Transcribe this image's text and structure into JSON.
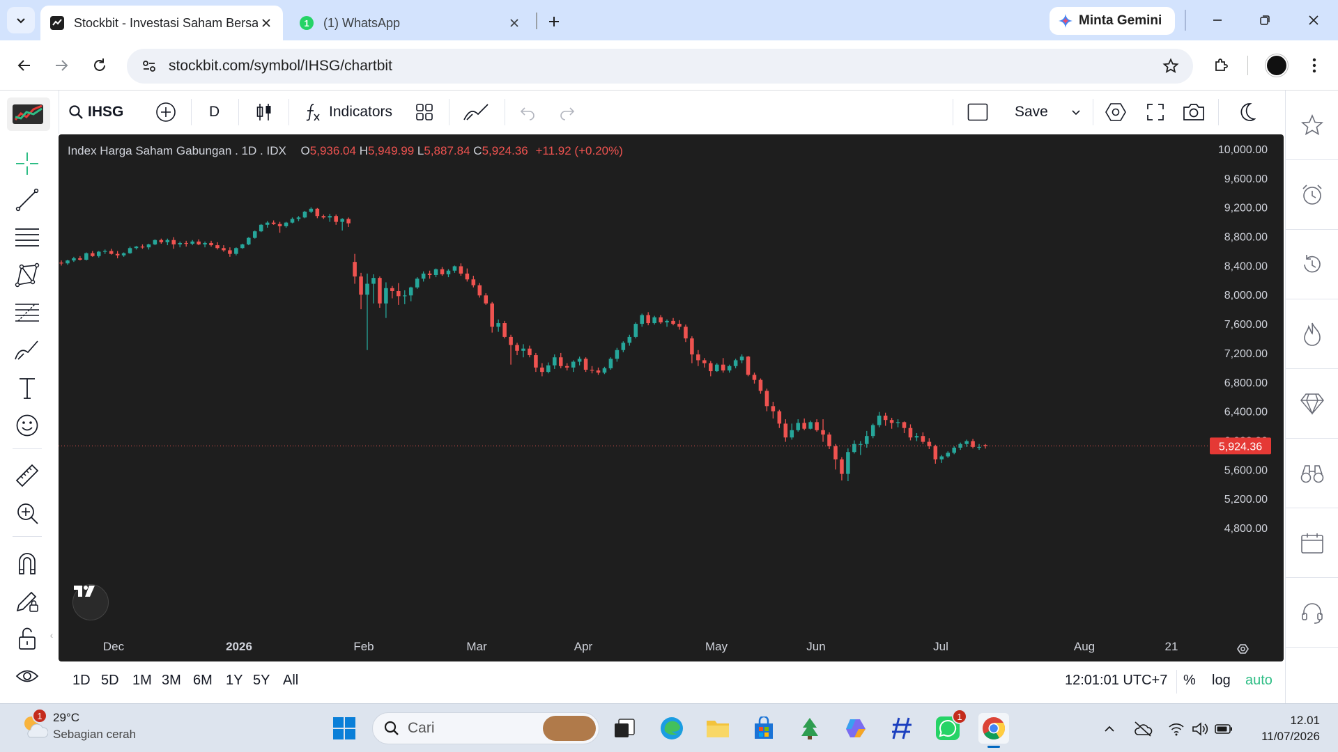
{
  "browser": {
    "tabs": [
      {
        "title": "Stockbit - Investasi Saham Bersama",
        "active": true
      },
      {
        "title": "(1) WhatsApp",
        "active": false,
        "badge": "1"
      }
    ],
    "gemini_label": "Minta Gemini",
    "url": "stockbit.com/symbol/IHSG/chartbit"
  },
  "app_header": {
    "symbol": "IHSG",
    "interval": "D",
    "indicators_label": "Indicators",
    "save_label": "Save"
  },
  "legend": {
    "name": "Index Harga Saham Gabungan",
    "sep": ".",
    "interval": "1D",
    "sep2": ".",
    "exchange": "IDX",
    "o_label": "O",
    "o_value": "5,936.04",
    "h_label": "H",
    "h_value": "5,949.99",
    "l_label": "L",
    "l_value": "5,887.84",
    "c_label": "C",
    "c_value": "5,924.36",
    "change": "+11.92 (+0.20%)"
  },
  "chart_data": {
    "type": "candlestick",
    "symbol": "IHSG",
    "interval": "1D",
    "ylim": [
      4500,
      10100
    ],
    "y_ticks": [
      "10,000.00",
      "9,600.00",
      "9,200.00",
      "8,800.00",
      "8,400.00",
      "8,000.00",
      "7,600.00",
      "7,200.00",
      "6,800.00",
      "6,400.00",
      "6,000.00",
      "5,600.00",
      "5,200.00",
      "4,800.00"
    ],
    "x_ticks": [
      "Dec",
      "2026",
      "Feb",
      "Mar",
      "Apr",
      "May",
      "Jun",
      "Jul",
      "Aug",
      "21"
    ],
    "last_price": "5,924.36",
    "last_price_value": 5924.36,
    "candles": [
      [
        8440,
        8470,
        8400,
        8430
      ],
      [
        8430,
        8480,
        8410,
        8470
      ],
      [
        8470,
        8520,
        8450,
        8500
      ],
      [
        8500,
        8530,
        8470,
        8480
      ],
      [
        8480,
        8580,
        8470,
        8570
      ],
      [
        8570,
        8600,
        8520,
        8530
      ],
      [
        8530,
        8600,
        8510,
        8590
      ],
      [
        8590,
        8620,
        8560,
        8600
      ],
      [
        8600,
        8630,
        8550,
        8560
      ],
      [
        8560,
        8600,
        8500,
        8540
      ],
      [
        8540,
        8580,
        8520,
        8570
      ],
      [
        8570,
        8660,
        8560,
        8640
      ],
      [
        8640,
        8670,
        8620,
        8660
      ],
      [
        8660,
        8690,
        8630,
        8650
      ],
      [
        8650,
        8700,
        8620,
        8690
      ],
      [
        8690,
        8760,
        8680,
        8750
      ],
      [
        8750,
        8770,
        8700,
        8720
      ],
      [
        8720,
        8770,
        8680,
        8750
      ],
      [
        8750,
        8790,
        8630,
        8690
      ],
      [
        8690,
        8730,
        8650,
        8710
      ],
      [
        8710,
        8740,
        8660,
        8700
      ],
      [
        8700,
        8750,
        8680,
        8730
      ],
      [
        8730,
        8760,
        8680,
        8690
      ],
      [
        8690,
        8730,
        8650,
        8710
      ],
      [
        8710,
        8740,
        8660,
        8680
      ],
      [
        8680,
        8720,
        8620,
        8640
      ],
      [
        8640,
        8680,
        8590,
        8610
      ],
      [
        8610,
        8650,
        8520,
        8560
      ],
      [
        8560,
        8650,
        8540,
        8640
      ],
      [
        8640,
        8700,
        8630,
        8690
      ],
      [
        8690,
        8790,
        8680,
        8780
      ],
      [
        8780,
        8880,
        8770,
        8870
      ],
      [
        8870,
        8970,
        8860,
        8960
      ],
      [
        8960,
        9010,
        8920,
        8990
      ],
      [
        8990,
        9020,
        8960,
        8970
      ],
      [
        8970,
        9000,
        8850,
        8940
      ],
      [
        8940,
        9000,
        8920,
        8990
      ],
      [
        8990,
        9060,
        8980,
        9040
      ],
      [
        9040,
        9080,
        9010,
        9060
      ],
      [
        9060,
        9150,
        9050,
        9140
      ],
      [
        9140,
        9200,
        9120,
        9180
      ],
      [
        9180,
        9190,
        9050,
        9080
      ],
      [
        9080,
        9100,
        9040,
        9060
      ],
      [
        9060,
        9110,
        9000,
        9080
      ],
      [
        9080,
        9100,
        8960,
        9000
      ],
      [
        9000,
        9050,
        8880,
        9040
      ],
      [
        9040,
        9060,
        8930,
        8980
      ],
      [
        8450,
        8560,
        8150,
        8250
      ],
      [
        8250,
        8300,
        7800,
        8000
      ],
      [
        8000,
        8290,
        7240,
        8150
      ],
      [
        8150,
        8280,
        7880,
        8230
      ],
      [
        8230,
        8250,
        7820,
        7880
      ],
      [
        7880,
        8170,
        7680,
        8090
      ],
      [
        8090,
        8120,
        7950,
        8050
      ],
      [
        8050,
        8160,
        7860,
        7980
      ],
      [
        7980,
        8060,
        7870,
        7990
      ],
      [
        7990,
        8110,
        7910,
        8100
      ],
      [
        8100,
        8240,
        8080,
        8220
      ],
      [
        8220,
        8320,
        8180,
        8290
      ],
      [
        8290,
        8330,
        8220,
        8270
      ],
      [
        8270,
        8360,
        8240,
        8350
      ],
      [
        8350,
        8380,
        8260,
        8280
      ],
      [
        8280,
        8350,
        8240,
        8330
      ],
      [
        8330,
        8400,
        8300,
        8390
      ],
      [
        8390,
        8430,
        8260,
        8290
      ],
      [
        8290,
        8360,
        8180,
        8210
      ],
      [
        8210,
        8260,
        8100,
        8130
      ],
      [
        8130,
        8160,
        7960,
        7990
      ],
      [
        7990,
        8020,
        7860,
        7880
      ],
      [
        7880,
        7900,
        7480,
        7560
      ],
      [
        7560,
        7660,
        7490,
        7610
      ],
      [
        7610,
        7640,
        7400,
        7420
      ],
      [
        7420,
        7450,
        7040,
        7310
      ],
      [
        7310,
        7340,
        7170,
        7230
      ],
      [
        7230,
        7320,
        7140,
        7260
      ],
      [
        7260,
        7300,
        7140,
        7170
      ],
      [
        7170,
        7200,
        6940,
        7000
      ],
      [
        7000,
        7060,
        6880,
        6940
      ],
      [
        6940,
        7070,
        6920,
        7030
      ],
      [
        7030,
        7180,
        6980,
        7140
      ],
      [
        7140,
        7200,
        6990,
        7020
      ],
      [
        7020,
        7060,
        6960,
        7000
      ],
      [
        7000,
        7100,
        6940,
        7080
      ],
      [
        7080,
        7150,
        7030,
        7120
      ],
      [
        7120,
        7140,
        6940,
        6970
      ],
      [
        6970,
        7020,
        6920,
        6960
      ],
      [
        6960,
        7000,
        6900,
        6930
      ],
      [
        6930,
        7010,
        6910,
        6990
      ],
      [
        6990,
        7140,
        6970,
        7120
      ],
      [
        7120,
        7270,
        7080,
        7240
      ],
      [
        7240,
        7360,
        7210,
        7340
      ],
      [
        7340,
        7450,
        7300,
        7420
      ],
      [
        7420,
        7620,
        7400,
        7600
      ],
      [
        7600,
        7740,
        7560,
        7720
      ],
      [
        7720,
        7760,
        7580,
        7610
      ],
      [
        7610,
        7710,
        7590,
        7690
      ],
      [
        7690,
        7720,
        7600,
        7620
      ],
      [
        7620,
        7660,
        7560,
        7640
      ],
      [
        7640,
        7680,
        7580,
        7600
      ],
      [
        7600,
        7650,
        7520,
        7560
      ],
      [
        7560,
        7590,
        7350,
        7400
      ],
      [
        7400,
        7430,
        7060,
        7180
      ],
      [
        7180,
        7240,
        7020,
        7100
      ],
      [
        7100,
        7130,
        7000,
        7060
      ],
      [
        7060,
        7090,
        6880,
        6950
      ],
      [
        6950,
        7060,
        6940,
        7040
      ],
      [
        7040,
        7130,
        6930,
        6960
      ],
      [
        6960,
        7040,
        6930,
        7020
      ],
      [
        7020,
        7120,
        6990,
        7100
      ],
      [
        7100,
        7180,
        7060,
        7150
      ],
      [
        7150,
        7160,
        6880,
        6900
      ],
      [
        6900,
        6930,
        6780,
        6830
      ],
      [
        6830,
        6850,
        6640,
        6680
      ],
      [
        6680,
        6710,
        6400,
        6470
      ],
      [
        6470,
        6530,
        6300,
        6400
      ],
      [
        6400,
        6420,
        6170,
        6230
      ],
      [
        6230,
        6290,
        5980,
        6040
      ],
      [
        6040,
        6230,
        6010,
        6140
      ],
      [
        6140,
        6290,
        6120,
        6240
      ],
      [
        6240,
        6300,
        6140,
        6160
      ],
      [
        6160,
        6270,
        6150,
        6250
      ],
      [
        6250,
        6290,
        6120,
        6140
      ],
      [
        6140,
        6290,
        5980,
        6080
      ],
      [
        6080,
        6110,
        5880,
        5920
      ],
      [
        5920,
        5950,
        5600,
        5740
      ],
      [
        5740,
        5770,
        5450,
        5540
      ],
      [
        5540,
        5890,
        5440,
        5840
      ],
      [
        5840,
        6000,
        5820,
        5950
      ],
      [
        5950,
        5990,
        5800,
        5950
      ],
      [
        5950,
        6130,
        5900,
        6060
      ],
      [
        6060,
        6230,
        6030,
        6210
      ],
      [
        6210,
        6390,
        6180,
        6340
      ],
      [
        6340,
        6380,
        6200,
        6280
      ],
      [
        6280,
        6310,
        6160,
        6240
      ],
      [
        6240,
        6290,
        6180,
        6250
      ],
      [
        6250,
        6260,
        6100,
        6170
      ],
      [
        6170,
        6220,
        6000,
        6040
      ],
      [
        6040,
        6100,
        5990,
        6060
      ],
      [
        6060,
        6110,
        5950,
        5980
      ],
      [
        5980,
        6030,
        5880,
        5920
      ],
      [
        5920,
        5940,
        5680,
        5740
      ],
      [
        5740,
        5800,
        5690,
        5780
      ],
      [
        5780,
        5850,
        5760,
        5830
      ],
      [
        5830,
        5920,
        5810,
        5900
      ],
      [
        5900,
        5970,
        5870,
        5950
      ],
      [
        5950,
        6010,
        5910,
        5990
      ],
      [
        5990,
        6020,
        5890,
        5910
      ],
      [
        5910,
        5950,
        5870,
        5910
      ],
      [
        5936.04,
        5949.99,
        5887.84,
        5924.36
      ]
    ]
  },
  "bottom_bar": {
    "ranges": [
      "1D",
      "5D",
      "1M",
      "3M",
      "6M",
      "1Y",
      "5Y",
      "All"
    ],
    "time": "12:01:01 UTC+7",
    "pct": "%",
    "log": "log",
    "auto": "auto"
  },
  "taskbar": {
    "weather_temp": "29°C",
    "weather_cond": "Sebagian cerah",
    "weather_badge": "1",
    "search_placeholder": "Cari",
    "whatsapp_badge": "1",
    "clock_time": "12.01",
    "clock_date": "11/07/2026"
  },
  "colors": {
    "up": "#26a69a",
    "down": "#ef5350",
    "chart_bg": "#1e1e1e",
    "auto_active": "#2ebd85"
  }
}
